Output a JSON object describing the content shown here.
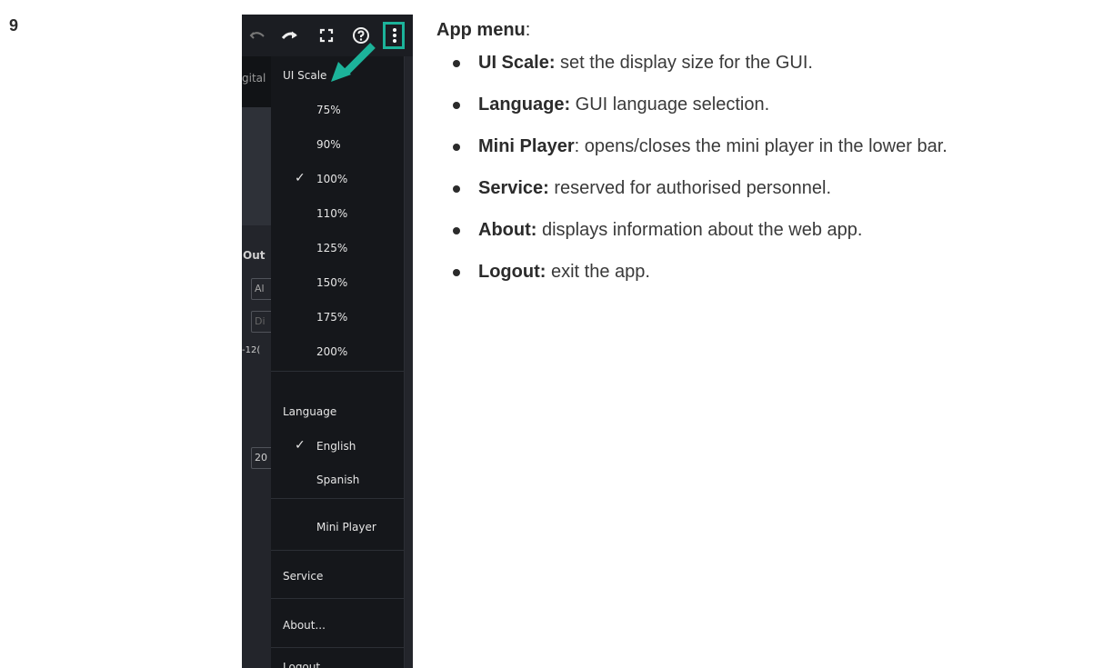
{
  "step_number": "9",
  "screenshot": {
    "background_labels": {
      "tab_fragment": "gital",
      "section_fragment": "Out",
      "field1": "Al",
      "field2": "Di",
      "value_fragment": "-12(",
      "field3": "20"
    },
    "menu": {
      "ui_scale_label": "UI Scale",
      "scales": [
        "75%",
        "90%",
        "100%",
        "110%",
        "125%",
        "150%",
        "175%",
        "200%"
      ],
      "selected_scale": "100%",
      "language_label": "Language",
      "languages": [
        "English",
        "Spanish"
      ],
      "selected_language": "English",
      "mini_player": "Mini Player",
      "service": "Service",
      "about": "About...",
      "logout": "Logout"
    },
    "icons": [
      "undo-icon",
      "redo-icon",
      "fullscreen-icon",
      "help-icon",
      "more-vertical-icon"
    ],
    "highlight_color": "#1cb39a"
  },
  "description": {
    "heading_bold": "App menu",
    "heading_rest": ":",
    "items": [
      {
        "term": "UI Scale:",
        "text": " set the display size for the GUI."
      },
      {
        "term": "Language:",
        "text": " GUI language selection."
      },
      {
        "term": "Mini Player",
        "text": ": opens/closes the mini player in the lower bar."
      },
      {
        "term": "Service:",
        "text": " reserved for authorised personnel."
      },
      {
        "term": "About:",
        "text": " displays information about the web app."
      },
      {
        "term": "Logout:",
        "text": " exit the app."
      }
    ]
  }
}
